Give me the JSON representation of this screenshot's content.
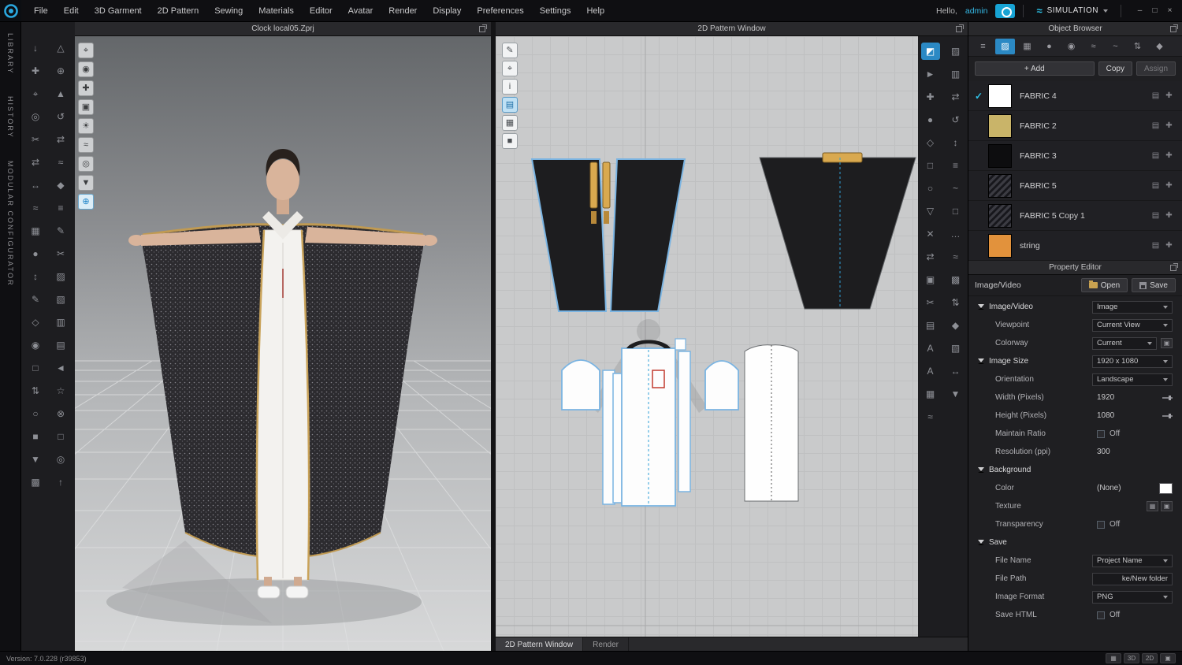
{
  "accent": {
    "cyan": "#29b1dd",
    "selection_blue": "#7ab4e2"
  },
  "topbar": {
    "menu": [
      "File",
      "Edit",
      "3D Garment",
      "2D Pattern",
      "Sewing",
      "Materials",
      "Editor",
      "Avatar",
      "Render",
      "Display",
      "Preferences",
      "Settings",
      "Help"
    ],
    "greeting": "Hello,",
    "username": "admin",
    "mode": "SIMULATION",
    "mode_icon": "≈"
  },
  "left_rail": {
    "tabs": [
      "LIBRARY",
      "HISTORY",
      "MODULAR CONFIGURATOR"
    ]
  },
  "viewport3d": {
    "title": "Clock local05.Zprj"
  },
  "pattern2d": {
    "title": "2D Pattern Window",
    "tabs": [
      {
        "label": "2D Pattern Window",
        "active": true
      },
      {
        "label": "Render"
      }
    ]
  },
  "toolbars": {
    "left_col1": [
      {
        "name": "simulate-drop-icon",
        "glyph": "↓"
      },
      {
        "name": "select-move-icon",
        "glyph": "✚"
      },
      {
        "name": "select-box-icon",
        "glyph": "⌖"
      },
      {
        "name": "pin-tool-icon",
        "glyph": "◎"
      },
      {
        "name": "sewing-edit-icon",
        "glyph": "✂"
      },
      {
        "name": "segment-sew-icon",
        "glyph": "⇄"
      },
      {
        "name": "free-sew-icon",
        "glyph": "↔"
      },
      {
        "name": "pleats-sew-icon",
        "glyph": "≈"
      },
      {
        "name": "solidify-icon",
        "glyph": "▦"
      },
      {
        "name": "tack-on-avatar-icon",
        "glyph": "●"
      },
      {
        "name": "measure-tape-icon",
        "glyph": "↕"
      },
      {
        "name": "pen-3d-icon",
        "glyph": "✎"
      },
      {
        "name": "fold-arrangement-icon",
        "glyph": "◇"
      },
      {
        "name": "button-tool-icon",
        "glyph": "◉"
      },
      {
        "name": "buttonhole-tool-icon",
        "glyph": "□"
      },
      {
        "name": "zipper-tool-icon",
        "glyph": "⇅"
      },
      {
        "name": "piping-tool-icon",
        "glyph": "○"
      },
      {
        "name": "binding-tool-icon",
        "glyph": "■"
      },
      {
        "name": "flatten-icon",
        "glyph": "▼"
      },
      {
        "name": "uv-grid-icon",
        "glyph": "▩"
      }
    ],
    "left_col2": [
      {
        "name": "avatar-tool-icon",
        "glyph": "△"
      },
      {
        "name": "arrange-points-icon",
        "glyph": "⊕"
      },
      {
        "name": "hanger-icon",
        "glyph": "▲"
      },
      {
        "name": "gizmo-rotate-icon",
        "glyph": "↺"
      },
      {
        "name": "scale-tool-icon",
        "glyph": "⇄"
      },
      {
        "name": "wind-tool-icon",
        "glyph": "≈"
      },
      {
        "name": "pose-tool-icon",
        "glyph": "◆"
      },
      {
        "name": "tape-avatar-icon",
        "glyph": "≡"
      },
      {
        "name": "stylus-icon",
        "glyph": "✎"
      },
      {
        "name": "trim-3d-icon",
        "glyph": "✂"
      },
      {
        "name": "fit-map-icon",
        "glyph": "▨"
      },
      {
        "name": "pressure-map-icon",
        "glyph": "▧"
      },
      {
        "name": "mesh-icon",
        "glyph": "▥"
      },
      {
        "name": "layer-tool-icon",
        "glyph": "▤"
      },
      {
        "name": "grain-icon",
        "glyph": "◄"
      },
      {
        "name": "steam-brush-icon",
        "glyph": "☆"
      },
      {
        "name": "magnet-icon",
        "glyph": "⊗"
      },
      {
        "name": "ruler-3d-icon",
        "glyph": "□"
      },
      {
        "name": "target-icon",
        "glyph": "◎"
      },
      {
        "name": "reset-icon",
        "glyph": "↑"
      }
    ],
    "viewport3d": [
      {
        "name": "view-gizmo-icon",
        "glyph": "⌖"
      },
      {
        "name": "show-avatar-icon",
        "glyph": "◉"
      },
      {
        "name": "arrangement-icon",
        "glyph": "✚"
      },
      {
        "name": "snapshot-icon",
        "glyph": "▣"
      },
      {
        "name": "light-icon",
        "glyph": "☀"
      },
      {
        "name": "wind-icon",
        "glyph": "≈"
      },
      {
        "name": "pose-icon",
        "glyph": "◎"
      },
      {
        "name": "garment-fit-icon",
        "glyph": "▼"
      },
      {
        "name": "globe-view-icon",
        "glyph": "⊕",
        "active": true
      }
    ],
    "pattern2d": [
      {
        "name": "edit-texture-icon",
        "glyph": "✎"
      },
      {
        "name": "transform-icon",
        "glyph": "⌖"
      },
      {
        "name": "info-icon",
        "glyph": "i"
      },
      {
        "name": "layer-icon",
        "glyph": "▤",
        "active": true
      },
      {
        "name": "texture-grid-icon",
        "glyph": "▦"
      },
      {
        "name": "lock-icon",
        "glyph": "■"
      }
    ],
    "right_col1": [
      {
        "name": "transform-pattern-icon",
        "glyph": "◩",
        "active": true
      },
      {
        "name": "edit-pattern-icon",
        "glyph": "►"
      },
      {
        "name": "edit-point-icon",
        "glyph": "✚"
      },
      {
        "name": "add-point-icon",
        "glyph": "●"
      },
      {
        "name": "polygon-icon",
        "glyph": "◇"
      },
      {
        "name": "rectangle-icon",
        "glyph": "□"
      },
      {
        "name": "circle-icon",
        "glyph": "○"
      },
      {
        "name": "dart-icon",
        "glyph": "▽"
      },
      {
        "name": "notch-icon",
        "glyph": "✕"
      },
      {
        "name": "seam-icon",
        "glyph": "⇄"
      },
      {
        "name": "trace-icon",
        "glyph": "▣"
      },
      {
        "name": "cut-sew-icon",
        "glyph": "✂"
      },
      {
        "name": "grade-icon",
        "glyph": "▤"
      },
      {
        "name": "annotate-icon",
        "glyph": "A"
      },
      {
        "name": "text-icon",
        "glyph": "A"
      },
      {
        "name": "grid-pattern-icon",
        "glyph": "▦"
      },
      {
        "name": "puckering-icon",
        "glyph": "≈"
      }
    ],
    "right_col2": [
      {
        "name": "pattern-3d-sync-icon",
        "glyph": "▨"
      },
      {
        "name": "unfold-icon",
        "glyph": "▥"
      },
      {
        "name": "mirror-icon",
        "glyph": "⇄"
      },
      {
        "name": "rotate-icon",
        "glyph": "↺"
      },
      {
        "name": "flip-icon",
        "glyph": "↕"
      },
      {
        "name": "align-icon",
        "glyph": "≡"
      },
      {
        "name": "seamline-icon",
        "glyph": "~"
      },
      {
        "name": "internal-line-icon",
        "glyph": "□"
      },
      {
        "name": "baseline-icon",
        "glyph": "…"
      },
      {
        "name": "elastic-icon",
        "glyph": "≈"
      },
      {
        "name": "shirring-icon",
        "glyph": "▩"
      },
      {
        "name": "zipper-2d-icon",
        "glyph": "⇅"
      },
      {
        "name": "fold-arrange-icon",
        "glyph": "◆"
      },
      {
        "name": "texture-icon",
        "glyph": "▧"
      },
      {
        "name": "measure-2d-icon",
        "glyph": "↔"
      },
      {
        "name": "ruler-icon",
        "glyph": "▼"
      }
    ],
    "object_browser_tabs": [
      {
        "name": "scene-list-icon",
        "glyph": "≡"
      },
      {
        "name": "fabric-tab-icon",
        "glyph": "▨",
        "active": true
      },
      {
        "name": "graphic-tab-icon",
        "glyph": "▦"
      },
      {
        "name": "sphere-tab-icon",
        "glyph": "●"
      },
      {
        "name": "button-tab-icon",
        "glyph": "◉"
      },
      {
        "name": "topstitch-tab-icon",
        "glyph": "≈"
      },
      {
        "name": "puckering-tab-icon",
        "glyph": "~"
      },
      {
        "name": "zipper-tab-icon",
        "glyph": "⇅"
      },
      {
        "name": "trim-tab-icon",
        "glyph": "◆"
      }
    ],
    "view_switch": [
      {
        "name": "multi-window-icon",
        "glyph": "▦"
      },
      {
        "name": "view-3d-button",
        "label": "3D"
      },
      {
        "name": "view-2d-button",
        "label": "2D"
      },
      {
        "name": "overlay-view-icon",
        "glyph": "▣"
      }
    ]
  },
  "object_browser": {
    "title": "Object Browser",
    "add_label": "+ Add",
    "copy_label": "Copy",
    "assign_label": "Assign",
    "row_icons": {
      "detail": "▤",
      "edit": "✚"
    },
    "fabrics": [
      {
        "name": "FABRIC 4",
        "check": "✓",
        "swatch": "#ffffff"
      },
      {
        "name": "FABRIC 2",
        "swatch": "#c9b469"
      },
      {
        "name": "FABRIC 3",
        "swatch": "#0d0d0f"
      },
      {
        "name": "FABRIC 5",
        "swatch": "repeating-linear-gradient(135deg,#3b3b42 0 3px,#17171c 3px 6px)"
      },
      {
        "name": "FABRIC 5 Copy 1",
        "swatch": "repeating-linear-gradient(135deg,#3b3b42 0 3px,#17171c 3px 6px)"
      },
      {
        "name": "string",
        "swatch": "#e2923c"
      }
    ]
  },
  "property_editor": {
    "title": "Property Editor",
    "target_label": "Image/Video",
    "open_label": "Open",
    "save_label": "Save",
    "texture_icons": {
      "grid": "▦",
      "open": "▣"
    },
    "rows": {
      "image_video": {
        "label": "Image/Video",
        "value": "Image"
      },
      "viewpoint": {
        "label": "Viewpoint",
        "value": "Current View"
      },
      "colorway": {
        "label": "Colorway",
        "value": "Current"
      },
      "image_size": {
        "label": "Image Size",
        "value": "1920 x 1080"
      },
      "orientation": {
        "label": "Orientation",
        "value": "Landscape"
      },
      "width": {
        "label": "Width (Pixels)",
        "value": "1920"
      },
      "height": {
        "label": "Height (Pixels)",
        "value": "1080"
      },
      "maintain_ratio": {
        "label": "Maintain Ratio",
        "value": "Off"
      },
      "resolution": {
        "label": "Resolution (ppi)",
        "value": "300"
      },
      "background": {
        "label": "Background"
      },
      "color": {
        "label": "Color",
        "value": "(None)"
      },
      "texture": {
        "label": "Texture"
      },
      "transparency": {
        "label": "Transparency",
        "value": "Off"
      },
      "save": {
        "label": "Save"
      },
      "file_name": {
        "label": "File Name",
        "value": "Project Name"
      },
      "file_path": {
        "label": "File Path",
        "value": "ke/New folder"
      },
      "image_format": {
        "label": "Image Format",
        "value": "PNG"
      },
      "save_html": {
        "label": "Save HTML",
        "value": "Off"
      }
    }
  },
  "statusbar": {
    "version": "Version: 7.0.228 (r39853)"
  }
}
